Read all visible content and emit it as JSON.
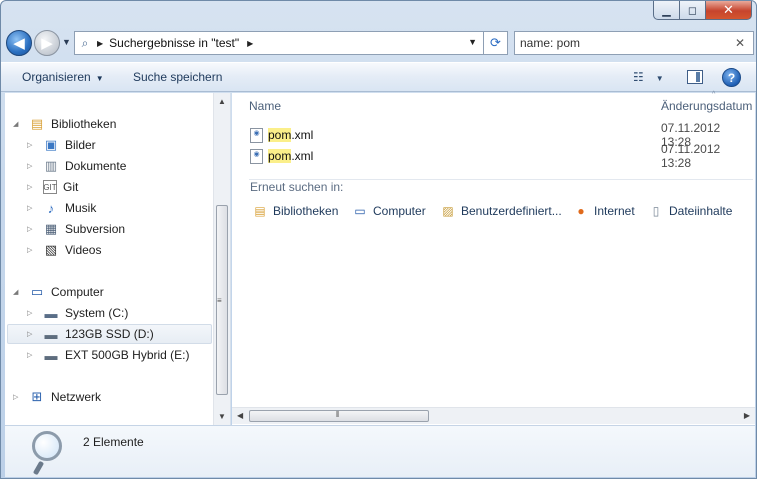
{
  "window": {
    "caption": {
      "minimize": "▁",
      "maximize": "◻",
      "close": "✕"
    }
  },
  "nav": {
    "back_glyph": "◀",
    "forward_glyph": "▶",
    "history_glyph": "▼",
    "address": {
      "separator": "▶",
      "crumb": "Suchergebnisse in \"test\"",
      "crumb_arrow": "▶",
      "dropdown": "▼"
    },
    "refresh_glyph": "⟳",
    "search": {
      "value": "name: pom",
      "clear": "✕"
    }
  },
  "toolbar": {
    "organize_label": "Organisieren",
    "organize_arrow": "▼",
    "save_search_label": "Suche speichern",
    "view_glyph": "☷",
    "view_arrow": "▼",
    "help_label": "?"
  },
  "sidebar": {
    "libraries": {
      "label": "Bibliotheken",
      "items": [
        {
          "label": "Bilder",
          "icon": "pictures-icon"
        },
        {
          "label": "Dokumente",
          "icon": "documents-icon"
        },
        {
          "label": "Git",
          "icon": "git-icon",
          "glyph": "GIT"
        },
        {
          "label": "Musik",
          "icon": "music-icon"
        },
        {
          "label": "Subversion",
          "icon": "subversion-icon"
        },
        {
          "label": "Videos",
          "icon": "videos-icon"
        }
      ]
    },
    "computer": {
      "label": "Computer",
      "items": [
        {
          "label": "System (C:)",
          "icon": "system-drive-icon"
        },
        {
          "label": "123GB SSD (D:)",
          "icon": "drive-icon",
          "selected": true
        },
        {
          "label": "EXT 500GB Hybrid (E:)",
          "icon": "drive-icon"
        }
      ]
    },
    "network": {
      "label": "Netzwerk"
    },
    "grip": "≡"
  },
  "content": {
    "columns": {
      "name": "Name",
      "date": "Änderungsdatum",
      "sort_arrow": "^"
    },
    "files": [
      {
        "match": "pom",
        "rest": ".xml",
        "date": "07.11.2012 13:28"
      },
      {
        "match": "pom",
        "rest": ".xml",
        "date": "07.11.2012 13:28"
      }
    ],
    "search_again": {
      "label": "Erneut suchen in:",
      "items": [
        {
          "label": "Bibliotheken",
          "icon": "libraries-icon"
        },
        {
          "label": "Computer",
          "icon": "computer-icon"
        },
        {
          "label": "Benutzerdefiniert...",
          "icon": "custom-folder-icon"
        },
        {
          "label": "Internet",
          "icon": "firefox-icon"
        },
        {
          "label": "Dateiinhalte",
          "icon": "file-contents-icon"
        }
      ]
    },
    "hscroll": {
      "left": "◀",
      "right": "▶",
      "grip": "⦀"
    }
  },
  "status": {
    "count": "2 Elemente"
  },
  "colors": {
    "accent": "#1e395b",
    "highlight": "#fbef8a",
    "close_red": "#c6442d"
  }
}
